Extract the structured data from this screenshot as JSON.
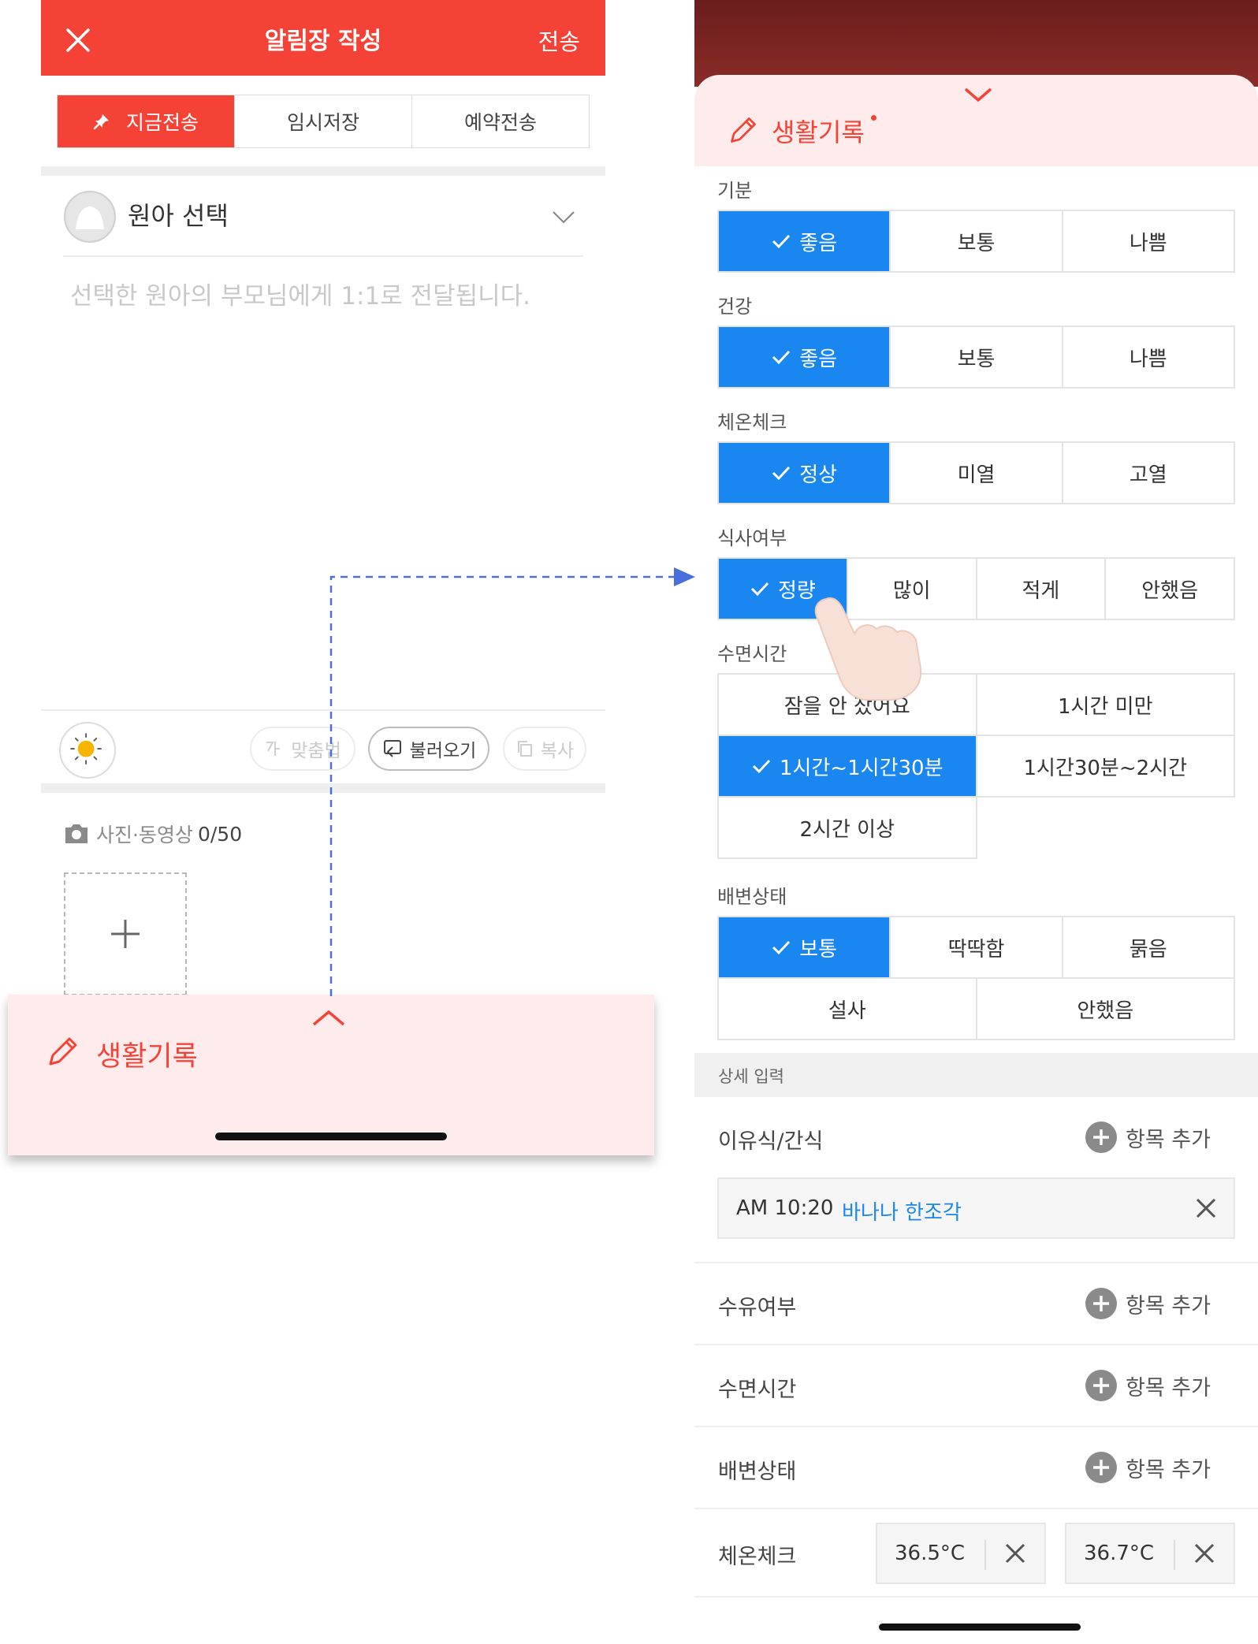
{
  "left": {
    "header": {
      "title": "알림장 작성",
      "send_label": "전송"
    },
    "send_modes": [
      "지금전송",
      "임시저장",
      "예약전송"
    ],
    "child_select": {
      "label": "원아 선택",
      "hint": "선택한 원아의 부모님에게 1:1로 전달됩니다."
    },
    "toolbar": {
      "spellcheck": "맞춤법",
      "load": "불러오기",
      "copy": "복사"
    },
    "photos": {
      "label": "사진·동영상",
      "count": "0/50"
    },
    "sheet": {
      "label": "생활기록"
    }
  },
  "right": {
    "sheet": {
      "label": "생활기록"
    },
    "mood": {
      "label": "기분",
      "options": [
        "좋음",
        "보통",
        "나쁨"
      ],
      "selected": "좋음"
    },
    "health": {
      "label": "건강",
      "options": [
        "좋음",
        "보통",
        "나쁨"
      ],
      "selected": "좋음"
    },
    "temp_check": {
      "label": "체온체크",
      "options": [
        "정상",
        "미열",
        "고열"
      ],
      "selected": "정상"
    },
    "meal": {
      "label": "식사여부",
      "options": [
        "정량",
        "많이",
        "적게",
        "안했음"
      ],
      "selected": "정량"
    },
    "sleep": {
      "label": "수면시간",
      "options": [
        "잠을 안 잤어요",
        "1시간 미만",
        "1시간~1시간30분",
        "1시간30분~2시간",
        "2시간 이상"
      ],
      "selected": "1시간~1시간30분"
    },
    "bowel": {
      "label": "배변상태",
      "options": [
        "보통",
        "딱딱함",
        "묽음",
        "설사",
        "안했음"
      ],
      "selected": "보통"
    },
    "detail": {
      "header": "상세 입력",
      "add_label": "항목 추가",
      "snack": {
        "label": "이유식/간식",
        "entry_time": "AM 10:20",
        "entry_text": "바나나 한조각"
      },
      "feeding": {
        "label": "수유여부"
      },
      "sleep": {
        "label": "수면시간"
      },
      "bowel": {
        "label": "배변상태"
      },
      "temperature": {
        "label": "체온체크",
        "values": [
          "36.5°C",
          "36.7°C"
        ]
      }
    }
  },
  "colors": {
    "brand_red": "#f44336",
    "select_blue": "#1a86f0",
    "sheet_pink": "#fdeceb"
  }
}
